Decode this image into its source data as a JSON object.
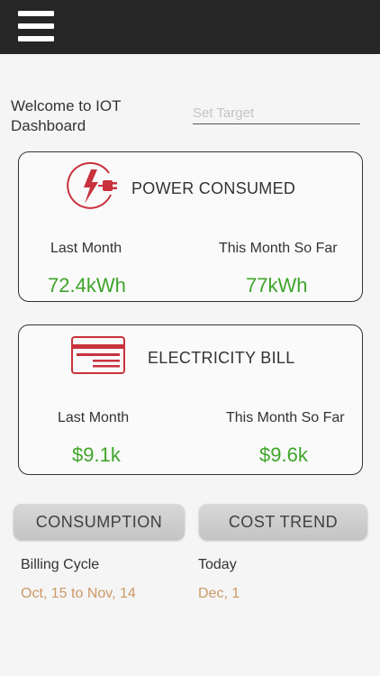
{
  "header": {
    "menu_icon": "hamburger-menu-icon",
    "background": "#262626"
  },
  "welcome": {
    "text": "Welcome to IOT Dashboard"
  },
  "target": {
    "placeholder": "Set Target",
    "value": ""
  },
  "power_card": {
    "icon": "power-plug-bolt-icon",
    "title": "POWER CONSUMED",
    "last_month_label": "Last Month",
    "last_month_value": "72.4kWh",
    "this_month_label": "This Month So Far",
    "this_month_value": "77kWh"
  },
  "bill_card": {
    "icon": "bill-card-icon",
    "title": "ELECTRICITY BILL",
    "last_month_label": "Last Month",
    "last_month_value": "$9.1k",
    "this_month_label": "This Month So Far",
    "this_month_value": "$9.6k"
  },
  "buttons": {
    "consumption_label": "CONSUMPTION",
    "cost_trend_label": "COST TREND"
  },
  "billing": {
    "cycle_label": "Billing Cycle",
    "cycle_value": "Oct, 15 to Nov, 14",
    "today_label": "Today",
    "today_value": "Dec, 1"
  },
  "colors": {
    "accent_red": "#c8323c",
    "value_green": "#3fa52a",
    "date_orange": "#cc9966"
  }
}
